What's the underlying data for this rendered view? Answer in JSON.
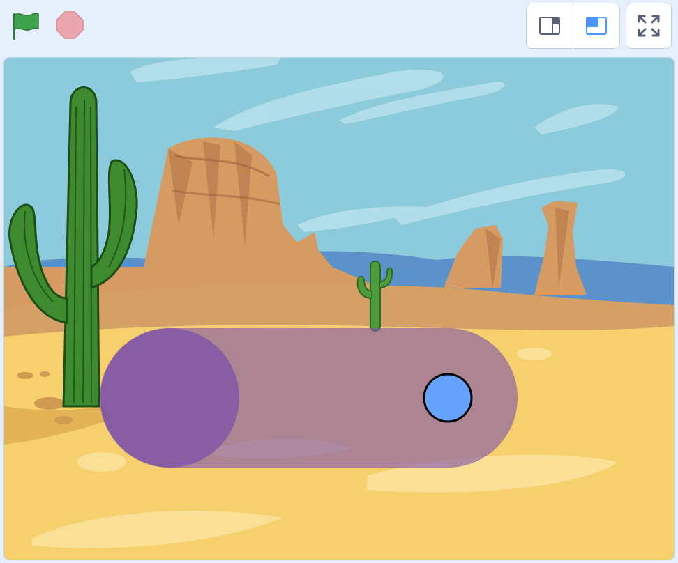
{
  "controls": {
    "green_flag": {
      "icon": "green-flag-icon",
      "color": "#3fa34d"
    },
    "stop": {
      "icon": "stop-sign-icon",
      "color": "#e8a3ab"
    }
  },
  "layout_toggle": {
    "small_stage": {
      "icon": "small-stage-icon",
      "selected": false
    },
    "normal_stage": {
      "icon": "normal-stage-icon",
      "selected": true
    },
    "accent": "#4c97ff"
  },
  "fullscreen": {
    "icon": "fullscreen-icon"
  },
  "stage": {
    "backdrop": "desert",
    "colors": {
      "sky": "#8ccbdb",
      "sand": "#f7d06e",
      "rock": "#d59b62",
      "cactus": "#2f7a27",
      "joystick_track": "#7e55a8",
      "joystick_knob": "#66a3ff"
    },
    "joystick": {
      "knob_position": 0.83
    }
  }
}
